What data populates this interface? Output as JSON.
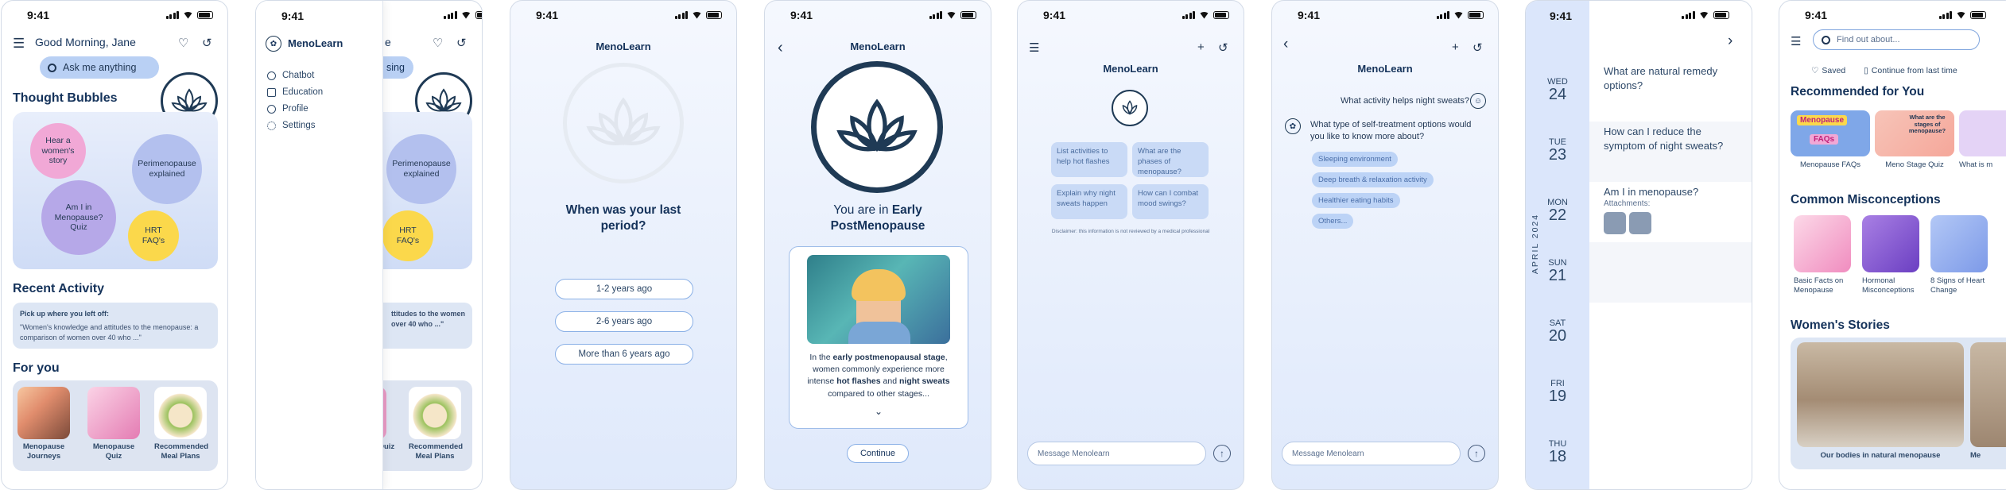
{
  "status_time": "9:41",
  "s1": {
    "greeting": "Good Morning, Jane",
    "ask": "Ask me anything",
    "thought_title": "Thought Bubbles",
    "bubbles": [
      "Hear a women's story",
      "Perimenopause explained",
      "Am I in Menopause? Quiz",
      "HRT FAQ's"
    ],
    "recent_title": "Recent Activity",
    "recent_pick": "Pick up where you left off:",
    "recent_text": "\"Women's knowledge and attitudes to the menopause: a comparison of women over 40 who ...\"",
    "foryou_title": "For you",
    "foryou": [
      "Menopause Journeys",
      "Menopause Quiz",
      "Recommended Meal Plans"
    ]
  },
  "s2": {
    "app": "MenoLearn",
    "menu": [
      "Chatbot",
      "Education",
      "Profile",
      "Settings"
    ],
    "partial_greeting": "e",
    "partial_ask": "sing",
    "partial_bubbles": [
      "Perimenopause explained",
      "HRT FAQ's"
    ],
    "partial_recent": "ttitudes to the women over 40 who ...\"",
    "partial_foryou": [
      "e Quiz",
      "Recommended Meal Plans"
    ]
  },
  "s3": {
    "app": "MenoLearn",
    "question": "When was your last period?",
    "options": [
      "1-2 years ago",
      "2-6 years ago",
      "More than 6 years ago"
    ]
  },
  "s4": {
    "app": "MenoLearn",
    "result_pre": "You are in ",
    "result_bold": "Early PostMenopause",
    "desc_1": "In the ",
    "desc_b1": "early postmenopausal stage",
    "desc_2": ", women commonly experience more intense ",
    "desc_b2": "hot flashes",
    "desc_3": " and ",
    "desc_b3": "night sweats",
    "desc_4": " compared to other stages...",
    "continue": "Continue"
  },
  "s5": {
    "app": "MenoLearn",
    "suggestions": [
      "List activities to help hot flashes",
      "What are the phases of menopause?",
      "Explain why night sweats happen",
      "How can I combat mood swings?"
    ],
    "disclaimer": "Disclaimer: this information is not reviewed by a medical professional",
    "placeholder": "Message Menolearn"
  },
  "s6": {
    "app": "MenoLearn",
    "user_msg": "What activity helps night sweats?",
    "bot_msg": "What type of self-treatment options would you like to know more about?",
    "pills": [
      "Sleeping environment",
      "Deep breath & relaxation activity",
      "Healthier eating habits",
      "Others..."
    ],
    "placeholder": "Message Menolearn"
  },
  "s7": {
    "month": "APRIL 2024",
    "days": [
      {
        "w": "WED",
        "n": "24"
      },
      {
        "w": "TUE",
        "n": "23"
      },
      {
        "w": "MON",
        "n": "22"
      },
      {
        "w": "SUN",
        "n": "21"
      },
      {
        "w": "SAT",
        "n": "20"
      },
      {
        "w": "FRI",
        "n": "19"
      },
      {
        "w": "THU",
        "n": "18"
      }
    ],
    "items": [
      "What are natural remedy options?",
      "How can I reduce the symptom of night sweats?",
      "Am I in menopause?"
    ],
    "attachments": "Attachments:"
  },
  "s8": {
    "search": "Find out about...",
    "saved": "Saved",
    "continue_last": "Continue from last time",
    "rec_title": "Recommended for You",
    "rec": [
      "Menopause FAQs",
      "Meno Stage Quiz",
      "What is m"
    ],
    "rec_art": [
      "Menopause",
      "FAQs",
      "What are the stages of menopause?"
    ],
    "mis_title": "Common Misconceptions",
    "mis": [
      "Basic Facts on Menopause",
      "Hormonal Misconceptions",
      "8 Signs of Heart Change"
    ],
    "stories_title": "Women's Stories",
    "story": "Our bodies in natural menopause",
    "story_partial": "Me"
  },
  "colors": {
    "navy": "#1f3a55",
    "pale_blue": "#dde6f4",
    "accent_blue": "#8ab0e6",
    "pink": "#f1a8d6",
    "lavender": "#b6a8e8",
    "periwinkle": "#b3c0ee",
    "yellow": "#fbd84b"
  }
}
